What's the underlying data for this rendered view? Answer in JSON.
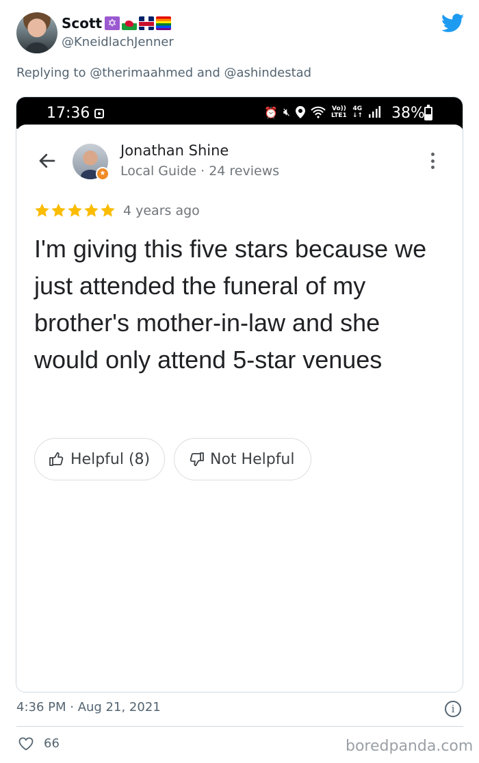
{
  "tweet": {
    "author_name": "Scott",
    "author_handle": "@KneidlachJenner",
    "reply_to": "Replying to @therimaahmed and @ashindestad",
    "timestamp": "4:36 PM · Aug 21, 2021",
    "like_count": "66",
    "flags": [
      "star-of-david-icon",
      "wales-flag-icon",
      "uk-flag-icon",
      "rainbow-flag-icon"
    ]
  },
  "phone_status": {
    "time": "17:36",
    "network_top": "Vo))",
    "network_bottom": "LTE1",
    "data_type": "4G",
    "battery": "38%"
  },
  "review": {
    "reviewer_name": "Jonathan Shine",
    "reviewer_subtitle": "Local Guide · 24 reviews",
    "rating": 5,
    "rating_max": 5,
    "age": "4 years ago",
    "text": "I'm giving this five stars because we just attended the funeral of my brother's mother-in-law and she would only attend 5-star venues",
    "helpful_label": "Helpful (8)",
    "not_helpful_label": "Not Helpful"
  },
  "watermark": "boredpanda.com",
  "colors": {
    "twitter_blue": "#1d9bf0",
    "star_yellow": "#fbbc04",
    "secondary_text": "#536471",
    "local_guide_orange": "#f08a24"
  }
}
